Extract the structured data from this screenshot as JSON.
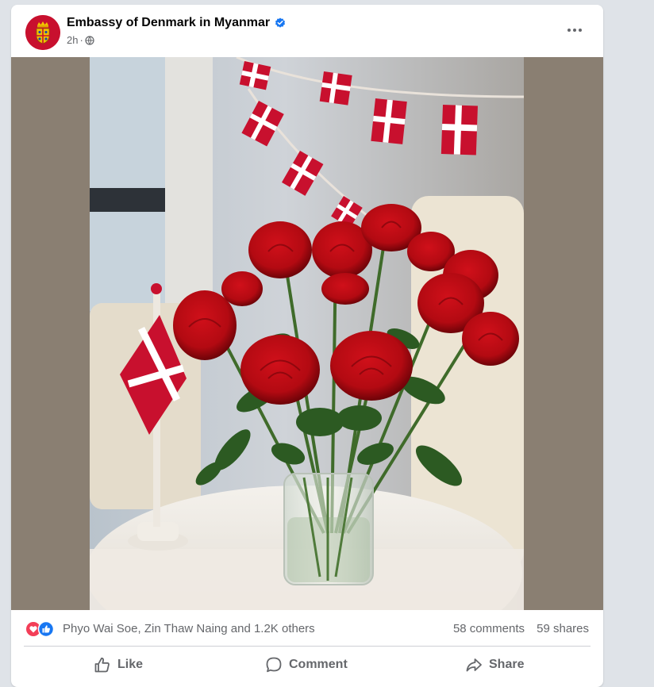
{
  "post": {
    "author": "Embassy of Denmark in Myanmar",
    "time": "2h",
    "time_separator": "·",
    "more_icon": "more-horizontal-icon",
    "verified_icon": "verified-badge-icon",
    "privacy_icon": "globe-icon"
  },
  "photo": {
    "subject_icon": "photo"
  },
  "engagement": {
    "reaction_icons": [
      "love-reaction-icon",
      "like-reaction-icon"
    ],
    "reactors": "Phyo Wai Soe, Zin Thaw Naing and 1.2K others",
    "comments": "58 comments",
    "shares": "59 shares"
  },
  "actions": {
    "like_label": "Like",
    "comment_label": "Comment",
    "share_label": "Share"
  },
  "colors": {
    "brand_red": "#c8102e",
    "facebook_blue": "#1877f2",
    "love_red": "#f33e58",
    "secondary_text": "#65676b"
  }
}
